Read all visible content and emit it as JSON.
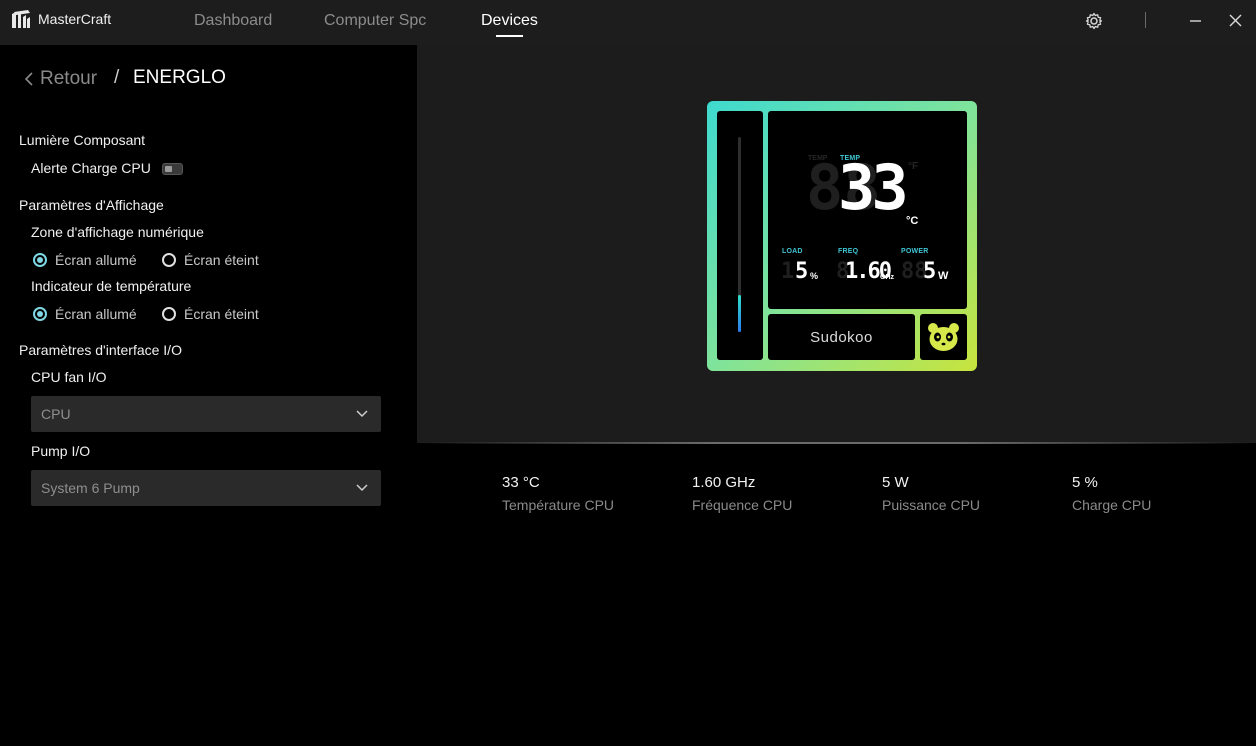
{
  "app": {
    "name": "MasterCraft"
  },
  "nav": {
    "tabs": [
      {
        "label": "Dashboard"
      },
      {
        "label": "Computer Spc"
      },
      {
        "label": "Devices"
      }
    ],
    "active_tab": "Devices"
  },
  "breadcrumb": {
    "back_label": "Retour",
    "separator": "/",
    "current": "ENERGLO"
  },
  "settings": {
    "component_light": {
      "title": "Lumière Composant",
      "cpu_load_alert_label": "Alerte Charge CPU",
      "cpu_load_alert_on": false
    },
    "display": {
      "title": "Paramètres d'Affichage",
      "numeric_zone": {
        "label": "Zone d'affichage numérique",
        "options": [
          "Écran allumé",
          "Écran éteint"
        ],
        "selected": "Écran allumé"
      },
      "temp_indicator": {
        "label": "Indicateur de température",
        "options": [
          "Écran allumé",
          "Écran éteint"
        ],
        "selected": "Écran allumé"
      }
    },
    "io": {
      "title": "Paramètres d'interface I/O",
      "cpu_fan": {
        "label": "CPU fan I/O",
        "value": "CPU"
      },
      "pump": {
        "label": "Pump I/O",
        "value": "System 6 Pump"
      }
    }
  },
  "device_display": {
    "temp_label": "TEMP",
    "temp_ghost_label": "TEMP",
    "temp_value": "33",
    "temp_ghost": "88",
    "unit_f": "°F",
    "unit_c": "°C",
    "load_label": "LOAD",
    "load_value": "5",
    "load_ghost": "1",
    "load_unit": "%",
    "freq_label": "FREQ",
    "freq_value": "1.60",
    "freq_ghost": "8",
    "freq_unit": "GHz",
    "power_label": "POWER",
    "power_value": "5",
    "power_ghost": "88",
    "power_unit": "W",
    "brand": "Sudokoo",
    "temp_bar_level": 0.27,
    "frame_colors": [
      "#3ed9cf",
      "#7fe39b",
      "#c8e43d"
    ],
    "accent_color": "#3fc6d4"
  },
  "stats": [
    {
      "value": "33 °C",
      "label": "Température CPU"
    },
    {
      "value": "1.60 GHz",
      "label": "Fréquence CPU"
    },
    {
      "value": "5 W",
      "label": "Puissance CPU"
    },
    {
      "value": "5 %",
      "label": "Charge CPU"
    }
  ],
  "icons": {
    "settings": "gear-icon",
    "minimize": "minimize-icon",
    "close": "close-icon",
    "back": "chevron-left-icon",
    "dropdown": "chevron-down-icon",
    "panda": "panda-icon"
  }
}
